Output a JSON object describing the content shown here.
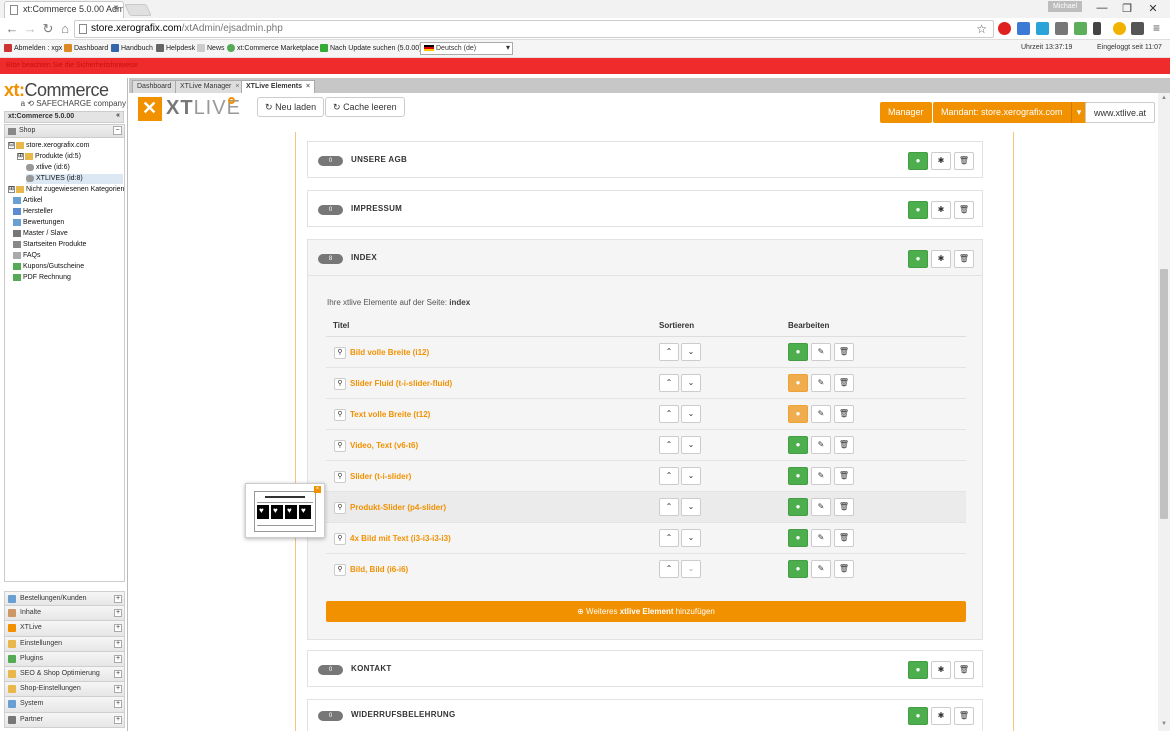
{
  "browser": {
    "tab_title": "xt:Commerce 5.0.00 Adm",
    "user_badge": "Michael",
    "url_host": "store.xerografix.com",
    "url_path": "/xtAdmin/ejsadmin.php",
    "window_controls": [
      "—",
      "❐",
      "✕"
    ]
  },
  "bookmarks": {
    "items": [
      "Abmelden : xgx",
      "Dashboard",
      "Handbuch",
      "Helpdesk",
      "News",
      "xt:Commerce Marketplace",
      "Nach Update suchen (5.0.00)"
    ],
    "language": "Deutsch (de)",
    "clock": "Uhrzeit 13:37:19",
    "logged_in": "Eingeloggt seit 11:07"
  },
  "warning_bar": "Bitte beachten Sie die Sicherheitshinweise",
  "sidebar": {
    "logo_main": "xt:",
    "logo_main2": "Commerce",
    "logo_sub": "a ⟲ SAFECHARGE company",
    "version": "xt:Commerce 5.0.00",
    "shop_header": "Shop",
    "tree": [
      {
        "label": "store.xerografix.com",
        "toggle": "⊟"
      },
      {
        "label": "Produkte (id:5)",
        "toggle": "⊞"
      },
      {
        "label": "xtlive (id:6)",
        "toggle": ""
      },
      {
        "label": "XTLIVES (id:8)",
        "toggle": ""
      },
      {
        "label": "Nicht zugewiesenen Kategorien",
        "toggle": "⊞"
      },
      {
        "label": "Artikel",
        "toggle": ""
      },
      {
        "label": "Hersteller",
        "toggle": ""
      },
      {
        "label": "Bewertungen",
        "toggle": ""
      },
      {
        "label": "Master / Slave",
        "toggle": ""
      },
      {
        "label": "Startseiten Produkte",
        "toggle": ""
      },
      {
        "label": "FAQs",
        "toggle": ""
      },
      {
        "label": "Kupons/Gutscheine",
        "toggle": ""
      },
      {
        "label": "PDF Rechnung",
        "toggle": ""
      }
    ],
    "accordion": [
      "Bestellungen/Kunden",
      "Inhalte",
      "XTLive",
      "Einstellungen",
      "Plugins",
      "SEO & Shop Optimierung",
      "Shop-Einstellungen",
      "System",
      "Partner"
    ]
  },
  "main_tabs": [
    {
      "label": "Dashboard",
      "closable": false
    },
    {
      "label": "XTLive Manager",
      "closable": true
    },
    {
      "label": "XTLive Elements",
      "closable": true
    }
  ],
  "header": {
    "logo": "XT",
    "logo2": "LIVE",
    "reload_label": "Neu laden",
    "cache_label": "Cache leeren",
    "manager_label": "Manager",
    "client_label": "Mandant: store.xerografix.com",
    "site_label": "www.xtlive.at"
  },
  "pages": {
    "agb": {
      "name": "UNSERE AGB",
      "count": "0"
    },
    "impressum": {
      "name": "IMPRESSUM",
      "count": "0"
    },
    "index": {
      "name": "INDEX",
      "count": "8"
    },
    "kontakt": {
      "name": "KONTAKT",
      "count": "0"
    },
    "widerruf": {
      "name": "WIDERRUFSBELEHRUNG",
      "count": "0"
    }
  },
  "index_section": {
    "intro": "Ihre xtlive Elemente auf der Seite:",
    "intro_page": "index",
    "col_title": "Titel",
    "col_sort": "Sortieren",
    "col_edit": "Bearbeiten",
    "elements": [
      {
        "title": "Bild volle Breite (i12)",
        "visible": true
      },
      {
        "title": "Slider Fluid (t-i-slider-fluid)",
        "visible": false
      },
      {
        "title": "Text volle Breite (t12)",
        "visible": false
      },
      {
        "title": "Video, Text (v6-t6)",
        "visible": true
      },
      {
        "title": "Slider (t-i-slider)",
        "visible": true
      },
      {
        "title": "Produkt-Slider (p4-slider)",
        "visible": true
      },
      {
        "title": "4x Bild mit Text (i3-i3-i3-i3)",
        "visible": true
      },
      {
        "title": "Bild, Bild (i6-i6)",
        "visible": true
      }
    ],
    "add_prefix": "Weiteres",
    "add_bold": "xtlive Element",
    "add_suffix": "hinzufügen"
  },
  "icons": {
    "eye": "●",
    "gear": "✱",
    "trash": "🗑",
    "pencil": "✎",
    "up": "⌃",
    "down": "⌄",
    "search": "⚲",
    "refresh": "↻",
    "plus": "⊕",
    "caret": "▾"
  },
  "colors": {
    "accent": "#f29100",
    "green": "#4cae4c",
    "orange_btn": "#f0ad4e",
    "warning": "#f02b2b"
  }
}
